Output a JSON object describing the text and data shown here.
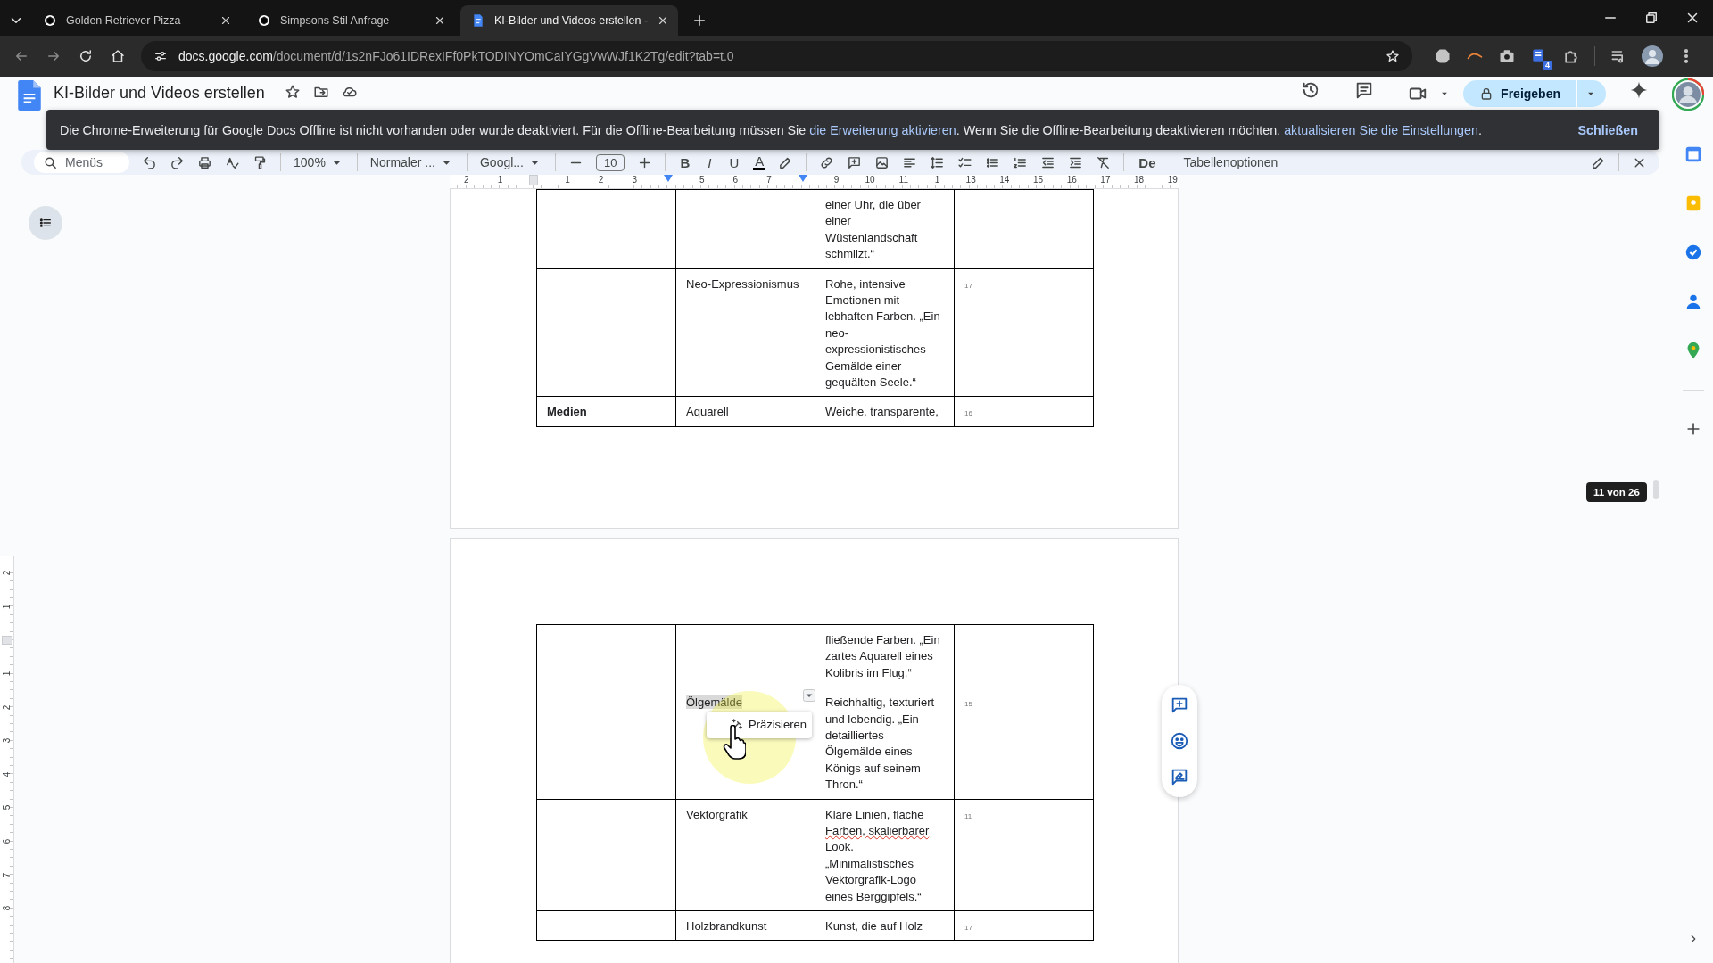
{
  "browser": {
    "tabs": [
      {
        "title": "Golden Retriever Pizza",
        "selected": false,
        "kind": "chat"
      },
      {
        "title": "Simpsons Stil Anfrage",
        "selected": false,
        "kind": "chat"
      },
      {
        "title": "KI-Bilder und Videos erstellen -",
        "selected": true,
        "kind": "docs"
      }
    ],
    "url": {
      "host": "docs.google.com",
      "path": "/document/d/1s2nFJo61IDRexIFf0PkTODINYOmCaIYGgVwWJf1K2Tg/edit?tab=t.0"
    },
    "extension_badge": "4"
  },
  "document": {
    "title": "KI-Bilder und Videos erstellen",
    "share_button": "Freigeben"
  },
  "offline_banner": {
    "message": [
      {
        "kind": "text",
        "text": "Die Chrome-Erweiterung für Google Docs Offline ist nicht vorhanden oder wurde deaktiviert. Für die Offline-Bearbeitung müssen Sie "
      },
      {
        "kind": "link",
        "text": "die Erweiterung aktivieren"
      },
      {
        "kind": "text",
        "text": ". Wenn Sie die Offline-Bearbeitung deaktivieren möchten, "
      },
      {
        "kind": "link",
        "text": "aktualisieren Sie die Einstellungen"
      },
      {
        "kind": "text",
        "text": "."
      }
    ],
    "close_button": "Schließen"
  },
  "toolbar": {
    "search": "Menüs",
    "zoom": "100%",
    "style": "Normaler ...",
    "font": "Googl...",
    "font_size": "10",
    "text_format": [
      "B",
      "I",
      "U",
      "A"
    ],
    "language": "De",
    "table_options": "Tabellenoptionen"
  },
  "ruler": {
    "horizontal": [
      {
        "kind": "number",
        "label": "2"
      },
      {
        "kind": "number",
        "label": "1"
      },
      {
        "kind": "column"
      },
      {
        "kind": "number",
        "label": "1"
      },
      {
        "kind": "number",
        "label": "2"
      },
      {
        "kind": "number",
        "label": "3"
      },
      {
        "kind": "indent"
      },
      {
        "kind": "number",
        "label": "5"
      },
      {
        "kind": "number",
        "label": "6"
      },
      {
        "kind": "number",
        "label": "7"
      },
      {
        "kind": "indent"
      },
      {
        "kind": "number",
        "label": "9"
      },
      {
        "kind": "number",
        "label": "10"
      },
      {
        "kind": "number",
        "label": "11"
      },
      {
        "kind": "number",
        "label": "1"
      },
      {
        "kind": "number",
        "label": "13"
      },
      {
        "kind": "number",
        "label": "14"
      },
      {
        "kind": "number",
        "label": "15"
      },
      {
        "kind": "number",
        "label": "16"
      },
      {
        "kind": "number",
        "label": "17"
      },
      {
        "kind": "number",
        "label": "18"
      },
      {
        "kind": "number",
        "label": "19"
      }
    ],
    "vertical": [
      {
        "kind": "number",
        "label": "2"
      },
      {
        "kind": "number",
        "label": "1"
      },
      {
        "kind": "column"
      },
      {
        "kind": "number",
        "label": "1"
      },
      {
        "kind": "number",
        "label": "2"
      },
      {
        "kind": "number",
        "label": "3"
      },
      {
        "kind": "number",
        "label": "4"
      },
      {
        "kind": "number",
        "label": "5"
      },
      {
        "kind": "number",
        "label": "6"
      },
      {
        "kind": "number",
        "label": "7"
      },
      {
        "kind": "number",
        "label": "8"
      }
    ]
  },
  "pages": [
    {
      "rows": [
        {
          "description": [
            {
              "text": "einer Uhr, die über einer Wüstenlandschaft schmilzt.“",
              "flagged": false
            }
          ]
        },
        {
          "style": {
            "text": "Neo-Expressionismus",
            "highlighted": false
          },
          "description": [
            {
              "text": "Rohe, intensive Emotionen mit lebhaften Farben. „Ein neo-expressionistisches Gemälde einer gequälten Seele.“",
              "flagged": false
            }
          ],
          "footnote": "17"
        },
        {
          "category": "Medien",
          "style": {
            "text": "Aquarell",
            "highlighted": false
          },
          "description": [
            {
              "text": "Weiche, transparente,",
              "flagged": false
            }
          ],
          "footnote": "16"
        }
      ]
    },
    {
      "rows": [
        {
          "description": [
            {
              "text": "fließende Farben. „Ein zartes Aquarell eines Kolibris im Flug.“",
              "flagged": false
            }
          ]
        },
        {
          "style": {
            "text": "Ölgemälde",
            "highlighted": true
          },
          "description": [
            {
              "text": "Reichhaltig, texturiert und lebendig. „Ein detailliertes Ölgemälde eines Königs auf seinem Thron.“",
              "flagged": false
            }
          ],
          "footnote": "15"
        },
        {
          "style": {
            "text": "Vektorgrafik",
            "highlighted": false
          },
          "description": [
            {
              "text": "Klare Linien, flache ",
              "flagged": false
            },
            {
              "text": "Farben, skalierbarer",
              "flagged": true
            },
            {
              "text": " Look. „Minimalistisches Vektorgrafik-Logo eines Berggipfels.“",
              "flagged": false
            }
          ],
          "footnote": "11"
        },
        {
          "style": {
            "text": "Holzbrandkunst",
            "highlighted": false
          },
          "description": [
            {
              "text": "Kunst, die auf Holz",
              "flagged": false
            }
          ],
          "footnote": "17"
        }
      ]
    }
  ],
  "refine_popup": {
    "label": "Präzisieren"
  },
  "page_counter": "11 von 26"
}
